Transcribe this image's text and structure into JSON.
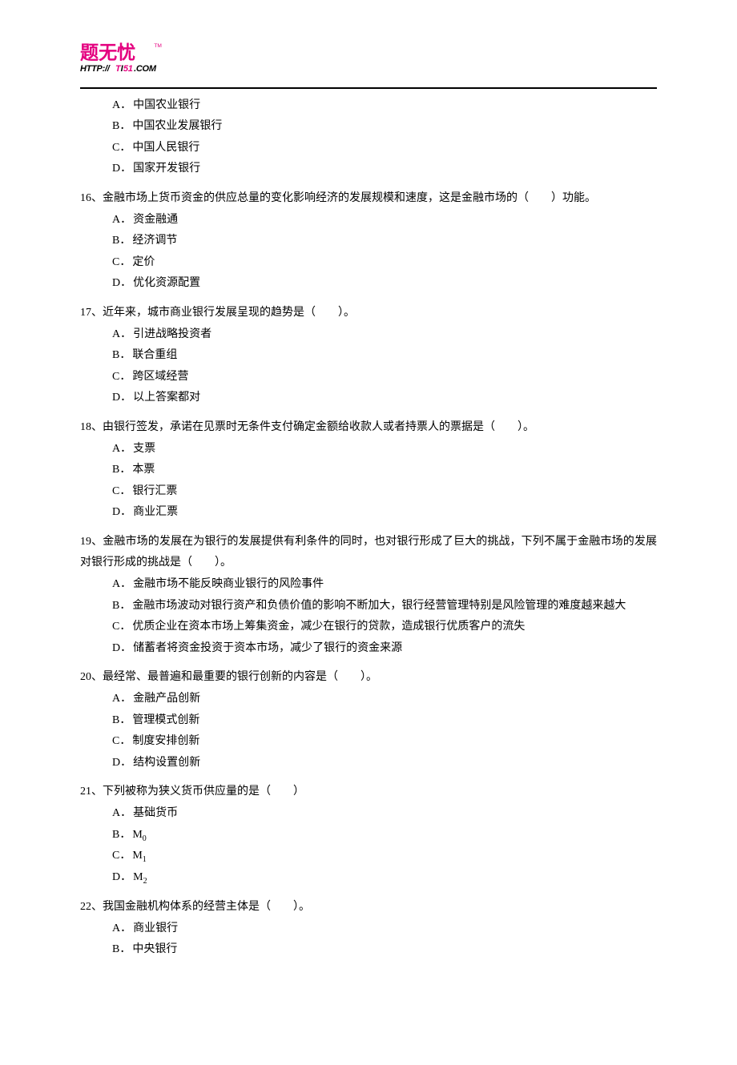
{
  "logo": {
    "top_text": "题无忧",
    "tm": "TM",
    "url_text": "HTTP://TI51.COM"
  },
  "questions_continued": {
    "q15_options": [
      {
        "letter": "A．",
        "text": "中国农业银行"
      },
      {
        "letter": "B．",
        "text": "中国农业发展银行"
      },
      {
        "letter": "C．",
        "text": "中国人民银行"
      },
      {
        "letter": "D．",
        "text": "国家开发银行"
      }
    ]
  },
  "questions": [
    {
      "stem": "16、金融市场上货币资金的供应总量的变化影响经济的发展规模和速度，这是金融市场的（　　）功能。",
      "options": [
        {
          "letter": "A．",
          "text": "资金融通"
        },
        {
          "letter": "B．",
          "text": "经济调节"
        },
        {
          "letter": "C．",
          "text": "定价"
        },
        {
          "letter": "D．",
          "text": "优化资源配置"
        }
      ]
    },
    {
      "stem": "17、近年来，城市商业银行发展呈现的趋势是（　　）。",
      "options": [
        {
          "letter": "A．",
          "text": "引进战略投资者"
        },
        {
          "letter": "B．",
          "text": "联合重组"
        },
        {
          "letter": "C．",
          "text": "跨区域经营"
        },
        {
          "letter": "D．",
          "text": "以上答案都对"
        }
      ]
    },
    {
      "stem": "18、由银行签发，承诺在见票时无条件支付确定金额给收款人或者持票人的票据是（　　）。",
      "options": [
        {
          "letter": "A．",
          "text": "支票"
        },
        {
          "letter": "B．",
          "text": "本票"
        },
        {
          "letter": "C．",
          "text": "银行汇票"
        },
        {
          "letter": "D．",
          "text": "商业汇票"
        }
      ]
    },
    {
      "stem": "19、金融市场的发展在为银行的发展提供有利条件的同时，也对银行形成了巨大的挑战，下列不属于金融市场的发展对银行形成的挑战是（　　）。",
      "options": [
        {
          "letter": "A．",
          "text": "金融市场不能反映商业银行的风险事件"
        },
        {
          "letter": "B．",
          "text": "金融市场波动对银行资产和负债价值的影响不断加大，银行经营管理特别是风险管理的难度越来越大"
        },
        {
          "letter": "C．",
          "text": "优质企业在资本市场上筹集资金，减少在银行的贷款，造成银行优质客户的流失"
        },
        {
          "letter": "D．",
          "text": "储蓄者将资金投资于资本市场，减少了银行的资金来源"
        }
      ]
    },
    {
      "stem": "20、最经常、最普遍和最重要的银行创新的内容是（　　）。",
      "options": [
        {
          "letter": "A．",
          "text": "金融产品创新"
        },
        {
          "letter": "B．",
          "text": "管理模式创新"
        },
        {
          "letter": "C．",
          "text": "制度安排创新"
        },
        {
          "letter": "D．",
          "text": "结构设置创新"
        }
      ]
    },
    {
      "stem": "21、下列被称为狭义货币供应量的是（　　）",
      "options": [
        {
          "letter": "A．",
          "text": "基础货币"
        },
        {
          "letter": "B．",
          "text": "M",
          "sub": "0"
        },
        {
          "letter": "C．",
          "text": "M",
          "sub": "1"
        },
        {
          "letter": "D．",
          "text": "M",
          "sub": "2"
        }
      ]
    },
    {
      "stem": "22、我国金融机构体系的经营主体是（　　）。",
      "options": [
        {
          "letter": "A．",
          "text": "商业银行"
        },
        {
          "letter": "B．",
          "text": "中央银行"
        }
      ]
    }
  ]
}
